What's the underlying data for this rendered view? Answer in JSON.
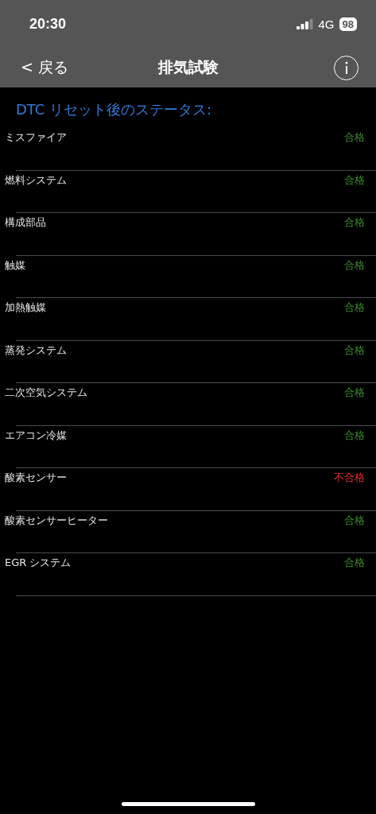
{
  "status_bar": {
    "time": "20:30",
    "network": "4G",
    "battery": "98"
  },
  "nav": {
    "back": "< 戻る",
    "title": "排気試験"
  },
  "heading": "DTC リセット後のステータス:",
  "tests": [
    {
      "name": "ミスファイア",
      "result": "合格",
      "failed": false
    },
    {
      "name": "燃料システム",
      "result": "合格",
      "failed": false
    },
    {
      "name": "構成部品",
      "result": "合格",
      "failed": false
    },
    {
      "name": "触媒",
      "result": "合格",
      "failed": false
    },
    {
      "name": "加熱触媒",
      "result": "合格",
      "failed": false
    },
    {
      "name": "蒸発システム",
      "result": "合格",
      "failed": false
    },
    {
      "name": "二次空気システム",
      "result": "合格",
      "failed": false
    },
    {
      "name": "エアコン冷媒",
      "result": "合格",
      "failed": false
    },
    {
      "name": "酸素センサー",
      "result": "不合格",
      "failed": true
    },
    {
      "name": "酸素センサーヒーター",
      "result": "合格",
      "failed": false
    },
    {
      "name": "EGR システム",
      "result": "合格",
      "failed": false
    }
  ]
}
